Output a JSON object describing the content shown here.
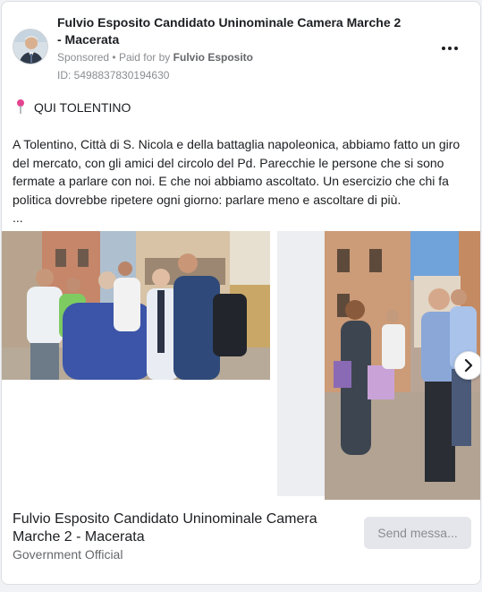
{
  "ad": {
    "page_name": "Fulvio Esposito Candidato Uninominale Camera Marche 2 - Macerata",
    "sponsored_label": "Sponsored",
    "paid_for_prefix": "Paid for by",
    "payer": "Fulvio Esposito",
    "ad_id": "ID: 5498837830194630",
    "more_icon": "more-options-icon"
  },
  "post": {
    "headline_icon": "pin-icon",
    "headline": "QUI TOLENTINO",
    "text": "A Tolentino, Città di S. Nicola e della battaglia napoleonica, abbiamo fatto un giro del mercato, con gli amici del circolo del Pd. Parecchie le persone che si sono fermate a parlare con noi. E che noi abbiamo ascoltato. Un esercizio che chi fa politica dovrebbe ripetere ogni giorno: parlare meno e ascoltare di più.",
    "more_indicator": "..."
  },
  "carousel": {
    "next_icon": "chevron-right-icon"
  },
  "footer": {
    "name": "Fulvio Esposito Candidato Uninominale Camera Marche 2 - Macerata",
    "category": "Government Official",
    "cta_label": "Send messa..."
  },
  "colors": {
    "background": "#f0f2f5",
    "card": "#ffffff",
    "text_primary": "#1c1e21",
    "text_secondary": "#65676b",
    "text_muted": "#8a8d91",
    "button_bg": "#e4e6eb",
    "pin": "#e4448f"
  }
}
